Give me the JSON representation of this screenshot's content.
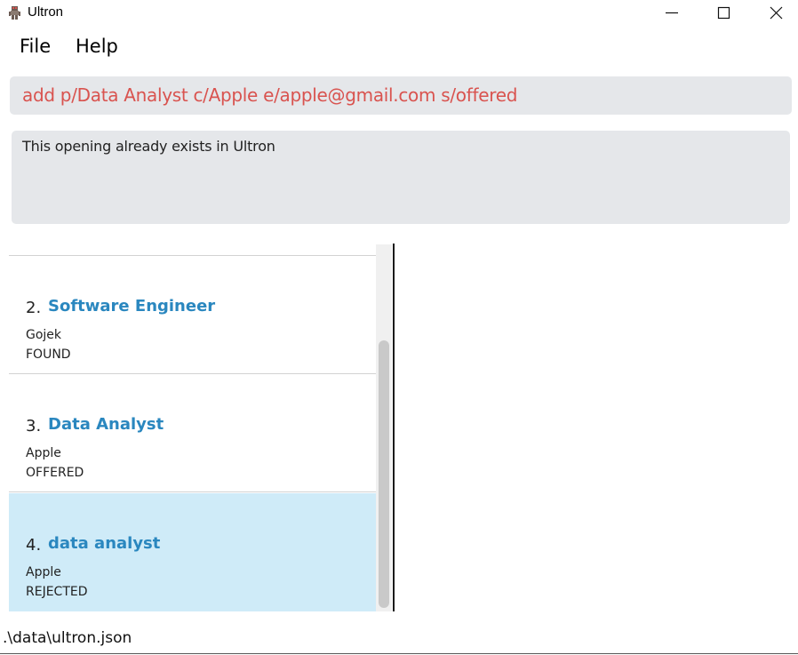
{
  "window": {
    "title": "Ultron",
    "icon": "ultron-app-icon",
    "controls": [
      "minimize-icon",
      "maximize-icon",
      "close-icon"
    ]
  },
  "menu": {
    "file": "File",
    "help": "Help"
  },
  "command": {
    "value": "add p/Data Analyst c/Apple e/apple@gmail.com s/offered",
    "text_color": "#d9534f"
  },
  "result": {
    "message": "This opening already exists in Ultron"
  },
  "openings": [
    {
      "index": "2.",
      "position": "Software Engineer",
      "company": "Gojek",
      "status": "FOUND",
      "selected": false
    },
    {
      "index": "3.",
      "position": "Data Analyst",
      "company": "Apple",
      "status": "OFFERED",
      "selected": false
    },
    {
      "index": "4.",
      "position": "data analyst",
      "company": "Apple",
      "status": "REJECTED",
      "selected": true
    }
  ],
  "colors": {
    "title_accent": "#2a87bf",
    "selected_row": "#cfebf8",
    "panel_bg": "#e5e7ea"
  },
  "status_bar": {
    "path": ".\\data\\ultron.json"
  }
}
